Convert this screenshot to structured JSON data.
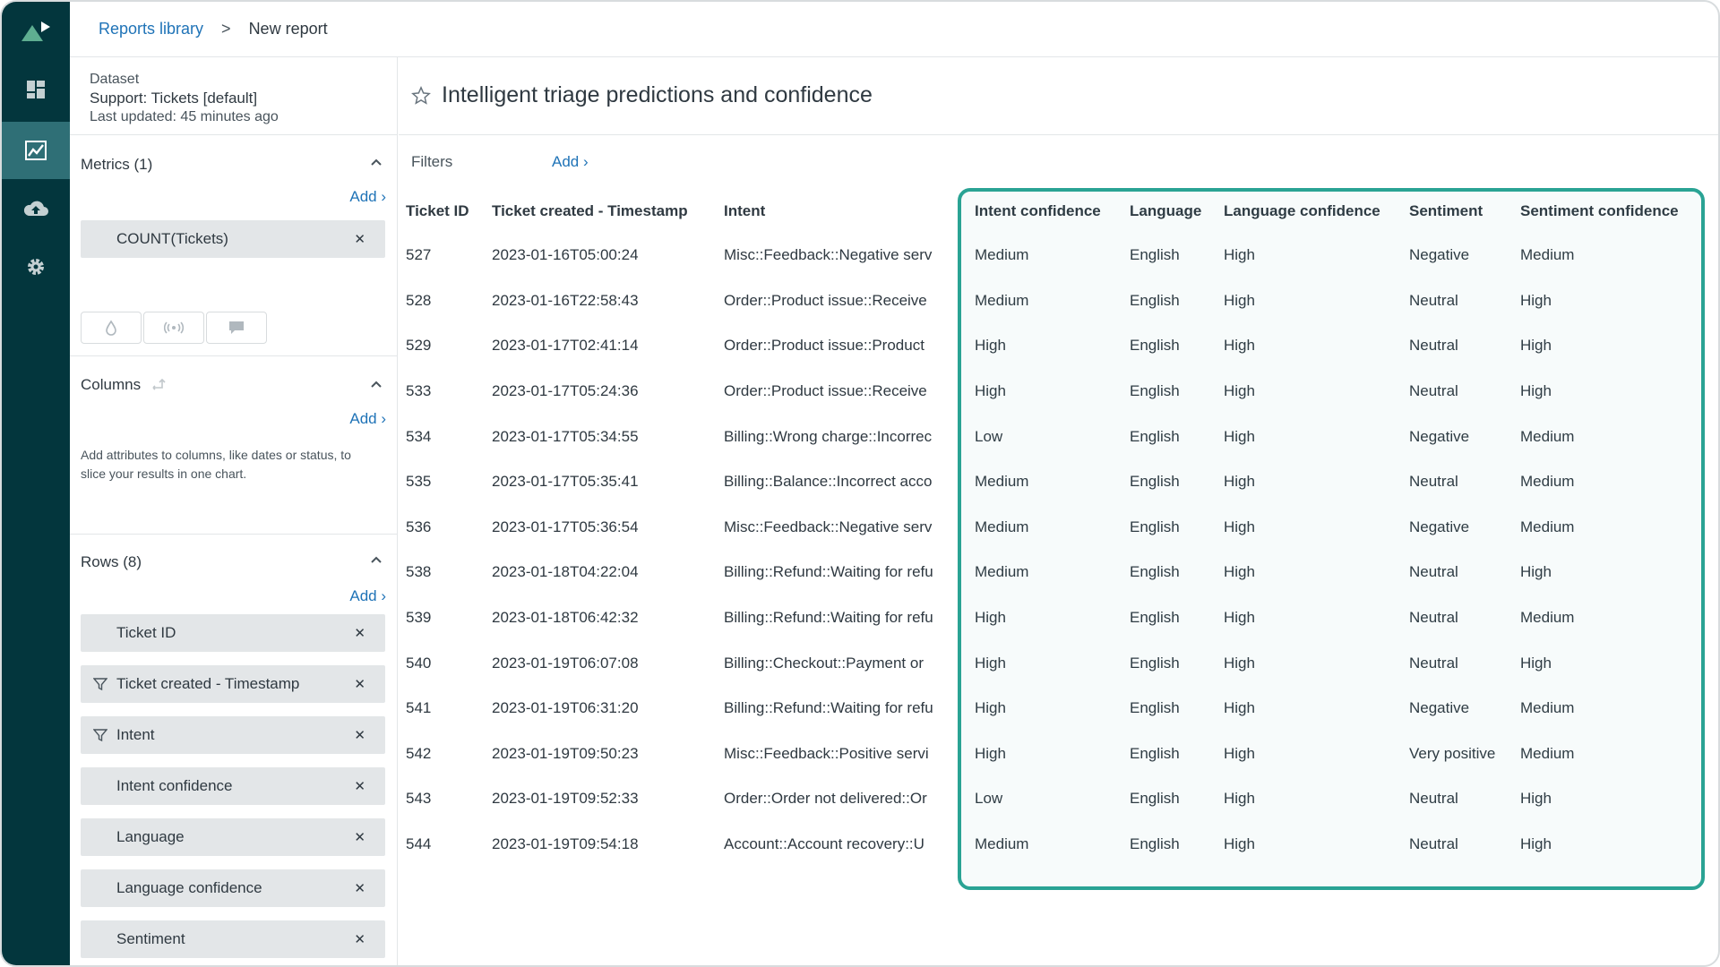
{
  "breadcrumb": {
    "library": "Reports library",
    "separator": ">",
    "current": "New report"
  },
  "dataset": {
    "label": "Dataset",
    "name": "Support: Tickets [default]",
    "updated": "Last updated: 45 minutes ago"
  },
  "metrics": {
    "title": "Metrics (1)",
    "add": "Add ›",
    "items": [
      "COUNT(Tickets)"
    ]
  },
  "columns": {
    "title": "Columns",
    "add": "Add ›",
    "hint": "Add attributes to columns, like dates or status, to slice your results in one chart."
  },
  "rows": {
    "title": "Rows (8)",
    "add": "Add ›",
    "items": [
      {
        "label": "Ticket ID"
      },
      {
        "label": "Ticket created - Timestamp"
      },
      {
        "label": "Intent"
      },
      {
        "label": "Intent confidence"
      },
      {
        "label": "Language"
      },
      {
        "label": "Language confidence"
      },
      {
        "label": "Sentiment"
      }
    ]
  },
  "report": {
    "title": "Intelligent triage predictions and confidence"
  },
  "filters": {
    "label": "Filters",
    "add": "Add ›"
  },
  "table": {
    "headers": [
      "Ticket ID",
      "Ticket created - Timestamp",
      "Intent",
      "Intent confidence",
      "Language",
      "Language confidence",
      "Sentiment",
      "Sentiment confidence"
    ],
    "rows": [
      [
        "527",
        "2023-01-16T05:00:24",
        "Misc::Feedback::Negative serv",
        "Medium",
        "English",
        "High",
        "Negative",
        "Medium"
      ],
      [
        "528",
        "2023-01-16T22:58:43",
        "Order::Product issue::Receive",
        "Medium",
        "English",
        "High",
        "Neutral",
        "High"
      ],
      [
        "529",
        "2023-01-17T02:41:14",
        "Order::Product issue::Product",
        "High",
        "English",
        "High",
        "Neutral",
        "High"
      ],
      [
        "533",
        "2023-01-17T05:24:36",
        "Order::Product issue::Receive",
        "High",
        "English",
        "High",
        "Neutral",
        "High"
      ],
      [
        "534",
        "2023-01-17T05:34:55",
        "Billing::Wrong charge::Incorrec",
        "Low",
        "English",
        "High",
        "Negative",
        "Medium"
      ],
      [
        "535",
        "2023-01-17T05:35:41",
        "Billing::Balance::Incorrect acco",
        "Medium",
        "English",
        "High",
        "Neutral",
        "Medium"
      ],
      [
        "536",
        "2023-01-17T05:36:54",
        "Misc::Feedback::Negative serv",
        "Medium",
        "English",
        "High",
        "Negative",
        "Medium"
      ],
      [
        "538",
        "2023-01-18T04:22:04",
        "Billing::Refund::Waiting for refu",
        "Medium",
        "English",
        "High",
        "Neutral",
        "High"
      ],
      [
        "539",
        "2023-01-18T06:42:32",
        "Billing::Refund::Waiting for refu",
        "High",
        "English",
        "High",
        "Neutral",
        "Medium"
      ],
      [
        "540",
        "2023-01-19T06:07:08",
        "Billing::Checkout::Payment or",
        "High",
        "English",
        "High",
        "Neutral",
        "High"
      ],
      [
        "541",
        "2023-01-19T06:31:20",
        "Billing::Refund::Waiting for refu",
        "High",
        "English",
        "High",
        "Negative",
        "Medium"
      ],
      [
        "542",
        "2023-01-19T09:50:23",
        "Misc::Feedback::Positive servi",
        "High",
        "English",
        "High",
        "Very positive",
        "Medium"
      ],
      [
        "543",
        "2023-01-19T09:52:33",
        "Order::Order not delivered::Or",
        "Low",
        "English",
        "High",
        "Neutral",
        "High"
      ],
      [
        "544",
        "2023-01-19T09:54:18",
        "Account::Account recovery::U",
        "Medium",
        "English",
        "High",
        "Neutral",
        "High"
      ]
    ]
  },
  "icons": {
    "logo": "zendesk-explore-logo",
    "nav": [
      "dashboard-icon",
      "reports-chart-icon",
      "cloud-upload-icon",
      "gear-icon"
    ]
  },
  "colors": {
    "rail": "#03363d",
    "rail_active": "#2f6f76",
    "link": "#1f73b7",
    "highlight": "#2aa394"
  }
}
